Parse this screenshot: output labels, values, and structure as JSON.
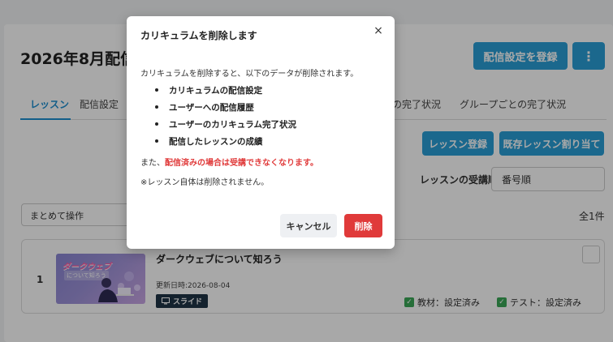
{
  "page": {
    "title": "2026年8月配信",
    "register_button": "配信設定を登録",
    "more_icon": "⋮"
  },
  "tabs": [
    {
      "label": "レッスン",
      "active": true
    },
    {
      "label": "配信設定"
    },
    {
      "label": "の完了状況"
    },
    {
      "label": "グループごとの完了状況"
    }
  ],
  "toolbar": {
    "lesson_register": "レッスン登録",
    "existing_assign": "既存レッスン割り当て",
    "order_label": "レッスンの受講順",
    "order_value": "番号順",
    "bulk_action": "まとめて操作",
    "total": "全1件"
  },
  "lesson": {
    "number": "1",
    "title": "ダークウェブについて知ろう",
    "thumb_title": "ダークウェブ",
    "thumb_sub": "について知ろう",
    "updated": "更新日時:2026-08-04",
    "badge": "スライド",
    "status_material": "教材：設定済み",
    "status_test": "テスト：設定済み"
  },
  "modal": {
    "title": "カリキュラムを削除します",
    "close": "×",
    "intro": "カリキュラムを削除すると、以下のデータが削除されます。",
    "items": [
      "カリキュラムの配信設定",
      "ユーザーへの配信履歴",
      "ユーザーのカリキュラム完了状況",
      "配信したレッスンの成績"
    ],
    "warning_prefix": "また、",
    "warning_text": "配信済みの場合は受講できなくなります。",
    "note": "※レッスン自体は削除されません。",
    "cancel": "キャンセル",
    "delete": "削除"
  },
  "colors": {
    "primary": "#2a9fd6",
    "danger": "#e03a3a",
    "success": "#3aa757",
    "badge": "#1f3446"
  }
}
